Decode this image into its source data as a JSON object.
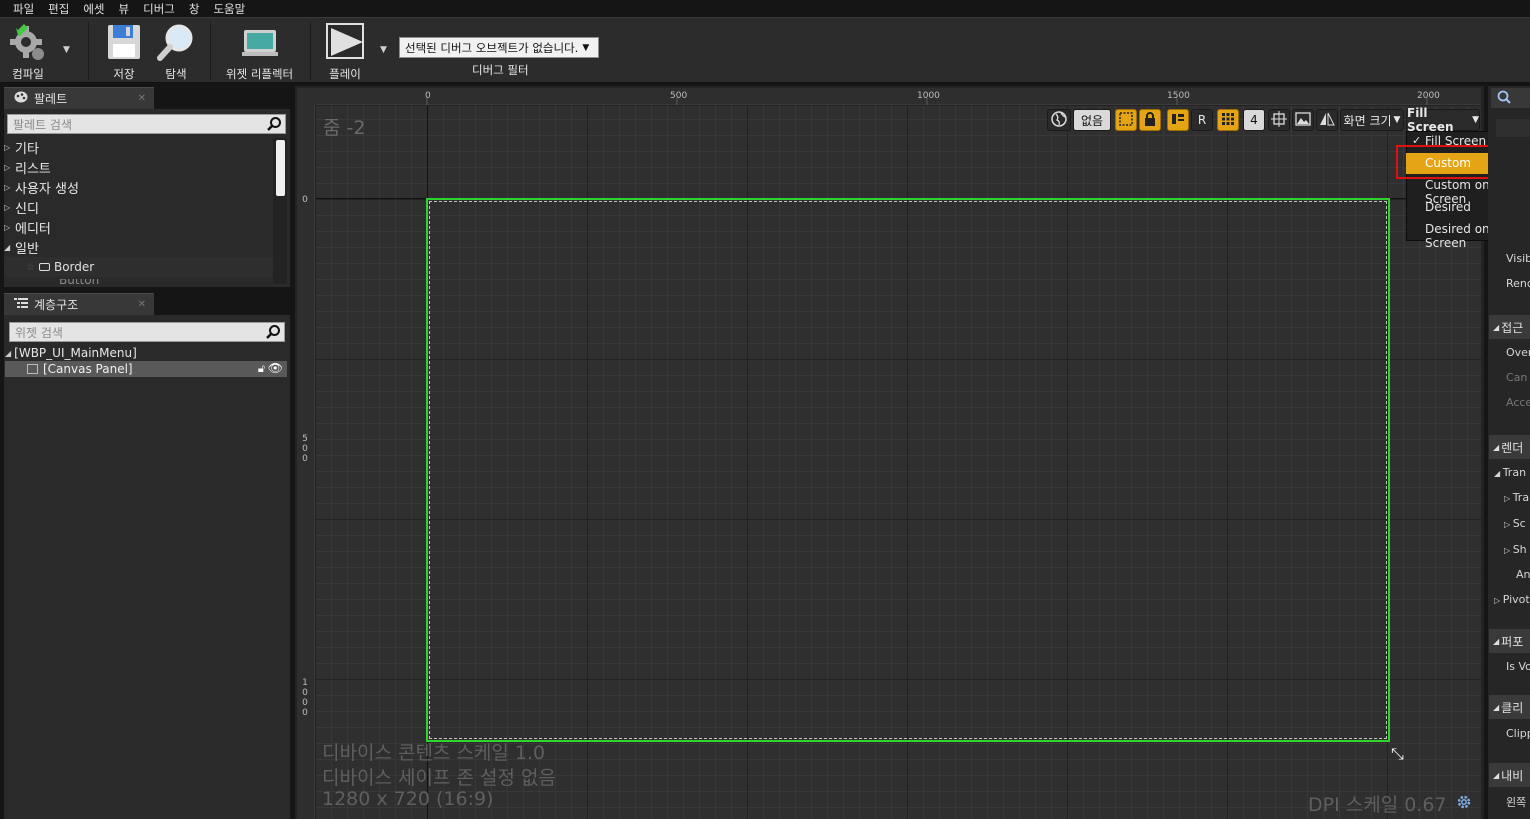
{
  "menu": [
    "파일",
    "편집",
    "에셋",
    "뷰",
    "디버그",
    "창",
    "도움말"
  ],
  "toolbar": {
    "compile": "컴파일",
    "save": "저장",
    "browse": "탐색",
    "widget_reflector": "위젯 리플렉터",
    "play": "플레이",
    "debug_object": "선택된 디버그 오브젝트가 없습니다.",
    "debug_filter": "디버그 필터"
  },
  "palette": {
    "tab": "팔레트",
    "search_placeholder": "팔레트 검색",
    "categories": [
      "기타",
      "리스트",
      "사용자 생성",
      "신디",
      "에디터",
      "일반"
    ],
    "items": [
      "Border",
      "Button"
    ]
  },
  "hierarchy": {
    "tab": "계층구조",
    "search_placeholder": "위젯 검색",
    "root": "[WBP_UI_MainMenu]",
    "child": "[Canvas Panel]"
  },
  "viewport": {
    "zoom": "줌 -2",
    "ruler_top": [
      "0",
      "500",
      "1000",
      "1500",
      "2000"
    ],
    "ruler_left": [
      "0",
      "5\n0\n0",
      "1\n0\n0\n0"
    ],
    "toolbar": {
      "none_label": "없음",
      "r_label": "R",
      "grid_num": "4",
      "screen_size": "화면 크기",
      "fill_screen": "Fill Screen"
    },
    "dropdown": {
      "items": [
        "Fill Screen",
        "Custom",
        "Custom on Screen",
        "Desired",
        "Desired on Screen"
      ],
      "checked": "Fill Screen",
      "highlighted": "Custom"
    },
    "info": {
      "content_scale": "디바이스 콘텐츠 스케일 1.0",
      "safe_zone": "디바이스 세이프 존 설정 없음",
      "resolution": "1280 x 720 (16:9)",
      "dpi": "DPI 스케일 0.67"
    }
  },
  "details": {
    "rows": [
      "Visib",
      "Rend",
      "접근",
      "Over",
      "Can",
      "Acce",
      "렌더",
      "Tran",
      "Tra",
      "Sc",
      "Sh",
      "An",
      "Pivot",
      "퍼포",
      "Is Vo",
      "클리",
      "Clipp",
      "내비",
      "왼쪽"
    ]
  },
  "colors": {
    "accent": "#e5a415",
    "selection_green": "#2ed32e",
    "highlight_red": "#e01010"
  }
}
